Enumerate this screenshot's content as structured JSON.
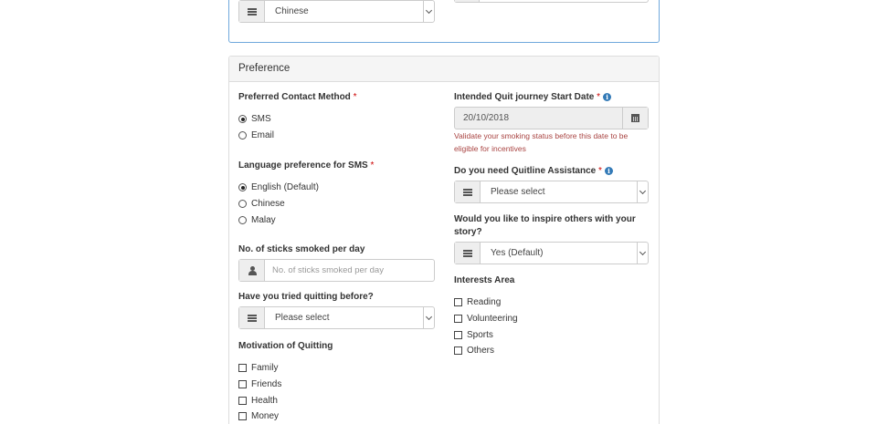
{
  "top": {
    "language_select_value": "Chinese"
  },
  "preference": {
    "title": "Preference",
    "contact_method": {
      "label": "Preferred Contact Method",
      "required_mark": "*",
      "options": [
        "SMS",
        "Email"
      ],
      "selected": "SMS"
    },
    "sms_language": {
      "label": "Language preference for SMS",
      "required_mark": "*",
      "options": [
        "English (Default)",
        "Chinese",
        "Malay"
      ],
      "selected": "English (Default)"
    },
    "sticks_per_day": {
      "label": "No. of sticks smoked per day",
      "placeholder": "No. of sticks smoked per day"
    },
    "tried_quitting": {
      "label": "Have you tried quitting before?",
      "value": "Please select"
    },
    "motivation": {
      "label": "Motivation of Quitting",
      "options": [
        "Family",
        "Friends",
        "Health",
        "Money"
      ]
    },
    "quit_start_date": {
      "label": "Intended Quit journey Start Date",
      "required_mark": "*",
      "value": "20/10/2018",
      "error_line1": "Validate your smoking status before this date to be",
      "error_line2": "eligible for incentives"
    },
    "quitline_assistance": {
      "label": "Do you need Quitline Assistance",
      "required_mark": "*",
      "value": "Please select"
    },
    "inspire_others": {
      "label_line1": "Would you like to inspire others with your",
      "label_line2": "story?",
      "value": "Yes (Default)"
    },
    "interests": {
      "label": "Interests Area",
      "options": [
        "Reading",
        "Volunteering",
        "Sports",
        "Others"
      ]
    }
  },
  "icons": {
    "list": "list-icon",
    "user": "user-icon",
    "calendar": "calendar-icon",
    "info": "info-icon",
    "info_glyph": "i"
  },
  "colors": {
    "panel_border_active": "#6fa8dc",
    "error_text": "#a94442",
    "required_mark": "#cc0000",
    "info_icon": "#337ab7"
  }
}
